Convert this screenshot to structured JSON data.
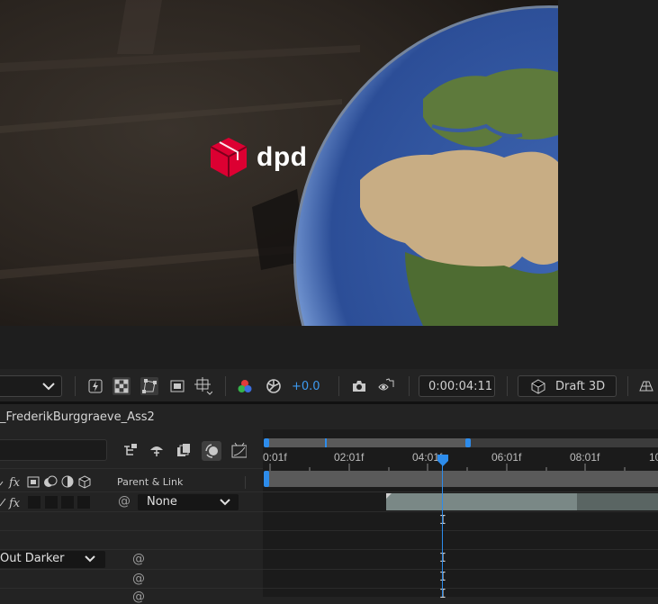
{
  "viewer": {
    "logo_text": "dpd",
    "logo_color": "#dc0032"
  },
  "toolbar": {
    "exposure_value": "+0.0",
    "timecode": "0:00:04:11",
    "renderer_label": "Draft 3D",
    "icons": [
      "dropdown-chevron-icon",
      "fast-preview-icon",
      "transparency-grid-icon",
      "mask-path-icon",
      "region-of-interest-icon",
      "snapping-guides-icon",
      "color-channels-icon",
      "reset-exposure-icon",
      "snapshot-camera-icon",
      "show-snapshot-icon",
      "draft-3d-cube-icon",
      "extended-viewer-icon"
    ]
  },
  "timeline": {
    "comp_name": "_FrederikBurggraeve_Ass2",
    "column_parent": "Parent & Link",
    "parent_value": "None",
    "blend_mode": "Out Darker",
    "ruler_ticks": [
      "0:01f",
      "02:01f",
      "04:01f",
      "06:01f",
      "08:01f",
      "10"
    ],
    "playhead_label": "04:01f",
    "accent_color": "#2d8ceb"
  }
}
